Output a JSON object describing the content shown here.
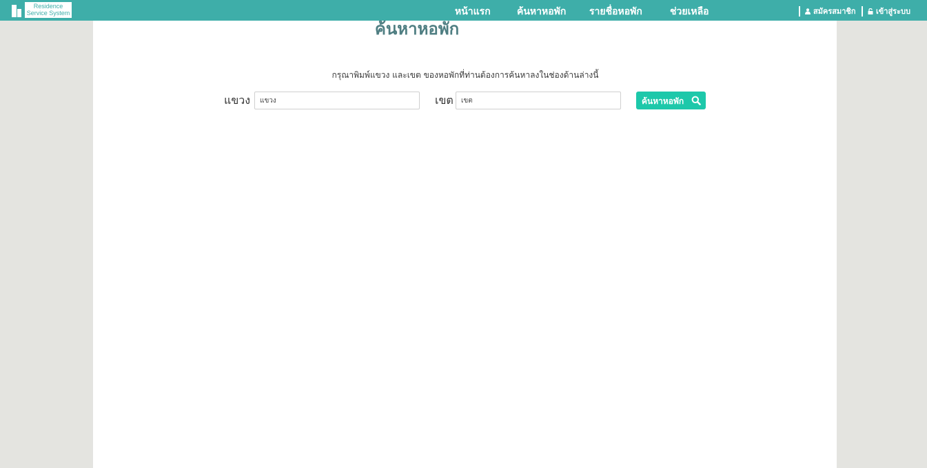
{
  "logo": {
    "line1": "Residence",
    "line2": "Service System",
    "icon": "building-icon"
  },
  "nav": {
    "items": [
      {
        "label": "หน้าแรก"
      },
      {
        "label": "ค้นหาหอพัก"
      },
      {
        "label": "รายชื่อหอพัก"
      },
      {
        "label": "ช่วยเหลือ"
      }
    ]
  },
  "account": {
    "register_label": "สมัครสมาชิก",
    "register_icon": "user-icon",
    "login_label": "เข้าสู่ระบบ",
    "login_icon": "lock-icon"
  },
  "search": {
    "title": "ค้นหาหอพัก",
    "instruction": "กรุณาพิมพ์แขวง และเขต ของหอพักที่ท่านต้องการค้นหาลงในช่องด้านล่างนี้",
    "subdistrict_label": "แขวง",
    "subdistrict_placeholder": "แขวง",
    "district_label": "เขต",
    "district_placeholder": "เขต",
    "button_label": "ค้นหาหอพัก",
    "button_icon": "search-icon"
  },
  "colors": {
    "header": "#3eaea9",
    "button": "#1dc8aa",
    "title": "#4f7e82",
    "page_bg": "#e4e4e0"
  }
}
